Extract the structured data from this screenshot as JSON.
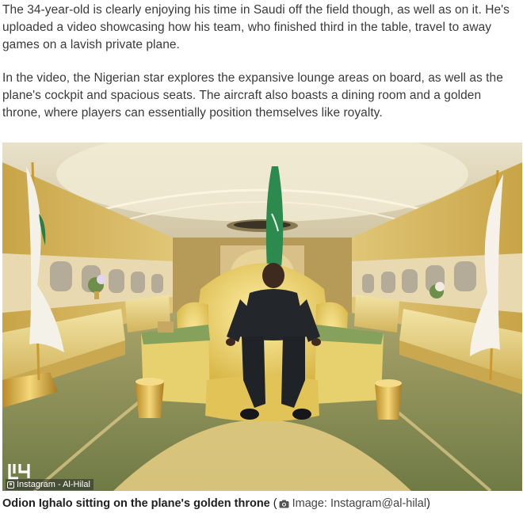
{
  "article": {
    "paragraphs": [
      "The 34-year-old is clearly enjoying his time in Saudi off the field though, as well as on it. He's uploaded a video showcasing how his team, who finished third in the table, travel to away games on a lavish private plane.",
      "In the video, the Nigerian star explores the expansive lounge areas on board, as well as the plane's cockpit and spacious seats. The aircraft also boasts a dining room and a golden throne, where players can essentially position themselves like royalty."
    ]
  },
  "photo": {
    "watermark_text": "Instagram - Al-Hilal",
    "logo_text": "Al-Hilal"
  },
  "caption": {
    "text": "Odion Ighalo sitting on the plane's golden throne",
    "open_paren": " (",
    "credit": "Image: Instagram@al-hilal",
    "close_paren": ")",
    "icon": "camera-icon"
  }
}
